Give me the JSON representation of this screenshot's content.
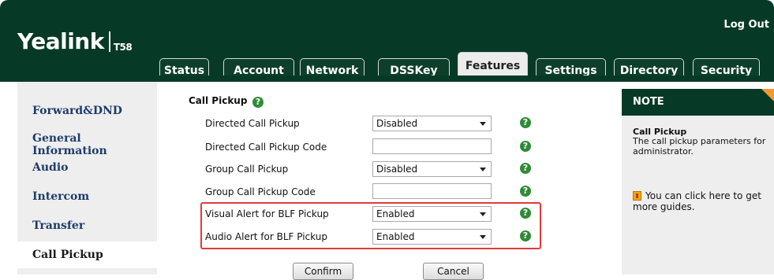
{
  "header": {
    "logo_brand": "Yealink",
    "logo_model": "T58",
    "logout": "Log Out"
  },
  "tabs": [
    {
      "label": "Status"
    },
    {
      "label": "Account"
    },
    {
      "label": "Network"
    },
    {
      "label": "DSSKey"
    },
    {
      "label": "Features",
      "active": true
    },
    {
      "label": "Settings"
    },
    {
      "label": "Directory"
    },
    {
      "label": "Security"
    }
  ],
  "sidebar": {
    "items": [
      {
        "label": "Forward&DND"
      },
      {
        "label": "General Information"
      },
      {
        "label": "Audio"
      },
      {
        "label": "Intercom"
      },
      {
        "label": "Transfer"
      },
      {
        "label": "Call Pickup",
        "active": true
      }
    ]
  },
  "main": {
    "section_title": "Call Pickup",
    "rows": [
      {
        "label": "Directed Call Pickup",
        "type": "select",
        "value": "Disabled"
      },
      {
        "label": "Directed Call Pickup Code",
        "type": "text",
        "value": ""
      },
      {
        "label": "Group Call Pickup",
        "type": "select",
        "value": "Disabled"
      },
      {
        "label": "Group Call Pickup Code",
        "type": "text",
        "value": ""
      },
      {
        "label": "Visual Alert for BLF Pickup",
        "type": "select",
        "value": "Enabled"
      },
      {
        "label": "Audio Alert for BLF Pickup",
        "type": "select",
        "value": "Enabled"
      }
    ],
    "confirm_label": "Confirm",
    "cancel_label": "Cancel"
  },
  "note": {
    "heading": "NOTE",
    "title": "Call Pickup",
    "text": "The call pickup parameters for administrator.",
    "guide_line1": "You can click here to get",
    "guide_line2": "more guides."
  },
  "colors": {
    "header_green": "#063a26",
    "help_green": "#2e8b35",
    "highlight_red": "#e23a3a",
    "note_corner_orange": "#f29a2e"
  }
}
